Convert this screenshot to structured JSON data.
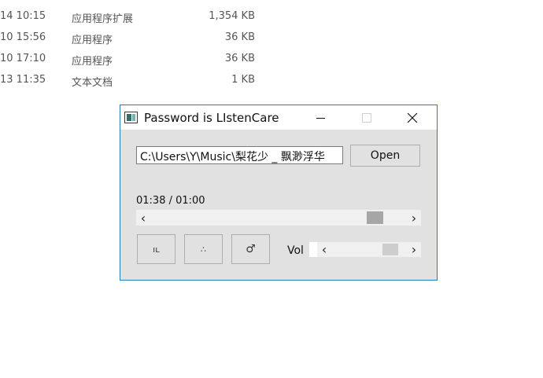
{
  "file_rows": [
    {
      "date": "14 10:15",
      "type": "应用程序扩展",
      "size": "1,354 KB"
    },
    {
      "date": "10 15:56",
      "type": "应用程序",
      "size": "36 KB"
    },
    {
      "date": "10 17:10",
      "type": "应用程序",
      "size": "36 KB"
    },
    {
      "date": "13 11:35",
      "type": "文本文档",
      "size": "1 KB"
    }
  ],
  "window": {
    "title": "Password is LIstenCare",
    "path_value": "C:\\Users\\Y\\Music\\梨花少 _ 飘渺浮华",
    "open_label": "Open",
    "time_text": "01:38 / 01:00",
    "seek_position": 0.9,
    "volume_position": 0.85,
    "buttons": {
      "a_glyph": "ıʟ",
      "b_glyph": "∴",
      "c_glyph": "♂"
    },
    "vol_label": "Vol"
  },
  "icons": {
    "scroll_left": "‹",
    "scroll_right": "›"
  },
  "colors": {
    "window_border": "#1f7fb6",
    "window_bg": "#e1e1e1"
  }
}
